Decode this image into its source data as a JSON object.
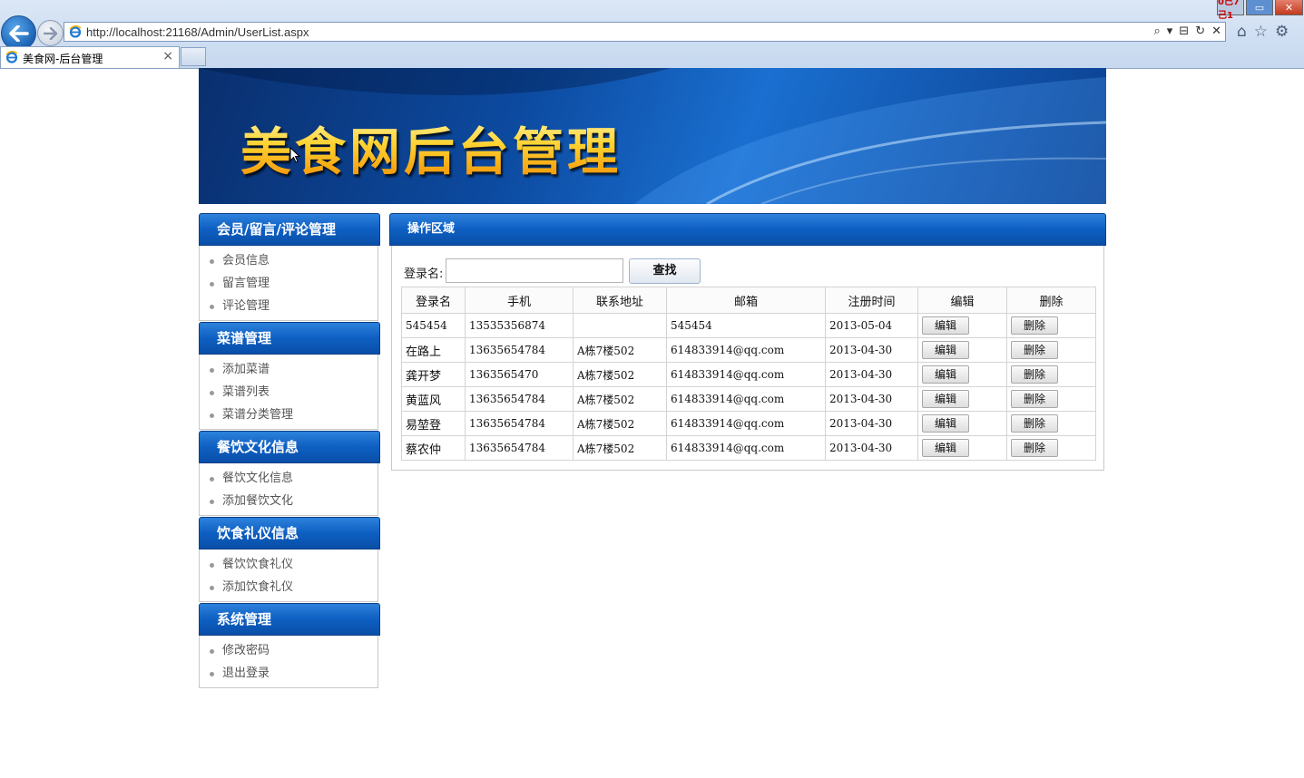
{
  "browser": {
    "url": "http://localhost:21168/Admin/UserList.aspx",
    "tab_title": "美食网-后台管理",
    "tab_close": "×",
    "window_min": "0己7己1",
    "window_max": "▭",
    "window_close": "✕"
  },
  "banner": {
    "title": "美食网后台管理"
  },
  "sidebar": [
    {
      "title": "会员/留言/评论管理",
      "items": [
        "会员信息",
        "留言管理",
        "评论管理"
      ]
    },
    {
      "title": "菜谱管理",
      "items": [
        "添加菜谱",
        "菜谱列表",
        "菜谱分类管理"
      ]
    },
    {
      "title": "餐饮文化信息",
      "items": [
        "餐饮文化信息",
        "添加餐饮文化"
      ]
    },
    {
      "title": "饮食礼仪信息",
      "items": [
        "餐饮饮食礼仪",
        "添加饮食礼仪"
      ]
    },
    {
      "title": "系统管理",
      "items": [
        "修改密码",
        "退出登录"
      ]
    }
  ],
  "panel": {
    "title": "操作区域",
    "search_label": "登录名:",
    "search_value": "",
    "search_button": "查找",
    "columns": [
      "登录名",
      "手机",
      "联系地址",
      "邮箱",
      "注册时间",
      "编辑",
      "删除"
    ],
    "edit_label": "编辑",
    "delete_label": "删除",
    "rows": [
      {
        "login": "545454",
        "phone": "13535356874",
        "address": "",
        "email": "545454",
        "date": "2013-05-04"
      },
      {
        "login": "在路上",
        "phone": "13635654784",
        "address": "A栋7楼502",
        "email": "614833914@qq.com",
        "date": "2013-04-30"
      },
      {
        "login": "龚开梦",
        "phone": "1363565470",
        "address": "A栋7楼502",
        "email": "614833914@qq.com",
        "date": "2013-04-30"
      },
      {
        "login": "黄蓝风",
        "phone": "13635654784",
        "address": "A栋7楼502",
        "email": "614833914@qq.com",
        "date": "2013-04-30"
      },
      {
        "login": "易堃登",
        "phone": "13635654784",
        "address": "A栋7楼502",
        "email": "614833914@qq.com",
        "date": "2013-04-30"
      },
      {
        "login": "蔡农仲",
        "phone": "13635654784",
        "address": "A栋7楼502",
        "email": "614833914@qq.com",
        "date": "2013-04-30"
      }
    ]
  },
  "colors": {
    "accent": "#0e5fc2",
    "banner": "#0c4aa0",
    "title_gold": "#ffd22e"
  }
}
